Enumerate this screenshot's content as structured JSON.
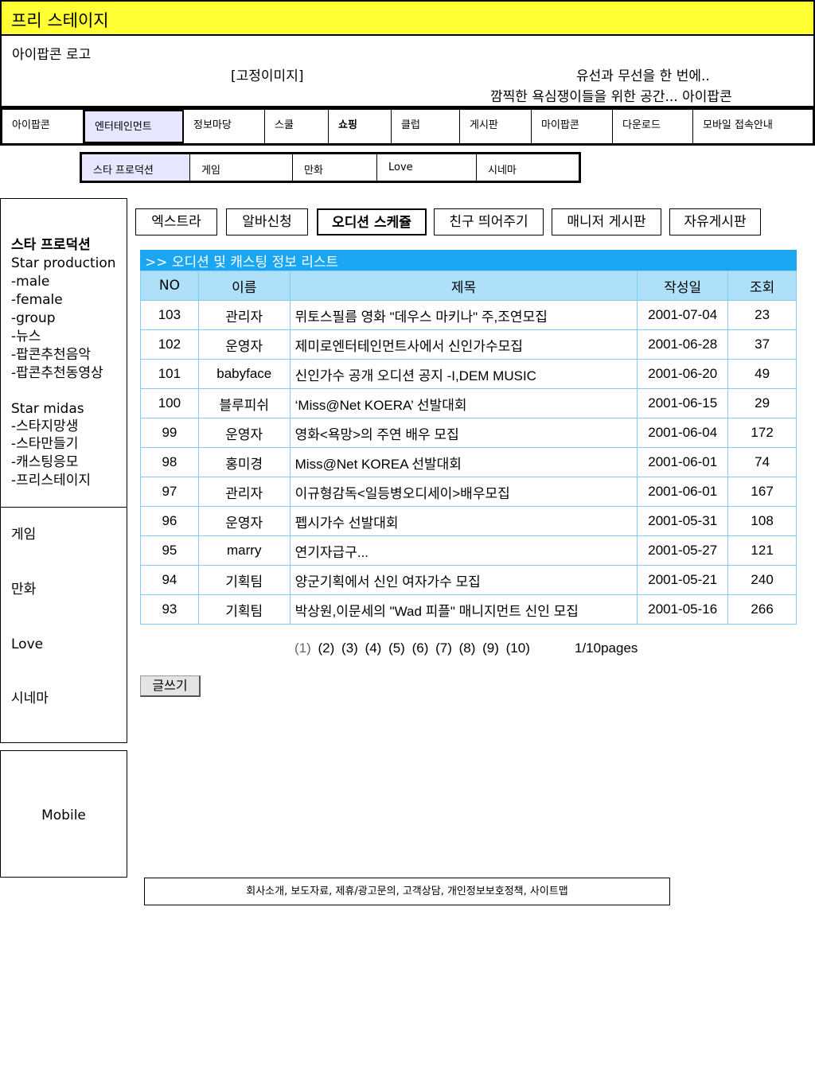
{
  "titlebar": {
    "title": "프리 스테이지"
  },
  "header": {
    "logo": "아이팝콘 로고",
    "fixed_image": "[고정이미지]",
    "slogan_1": "유선과 무선을 한 번에..",
    "slogan_2": "깜찍한 욕심쟁이들을 위한 공간... 아이팝콘"
  },
  "main_nav": [
    {
      "label": "아이팝콘"
    },
    {
      "label": "엔터테인먼트"
    },
    {
      "label": "정보마당"
    },
    {
      "label": "스쿨"
    },
    {
      "label": "쇼핑"
    },
    {
      "label": "클럽"
    },
    {
      "label": "게시판"
    },
    {
      "label": "마이팝콘"
    },
    {
      "label": "다운로드"
    },
    {
      "label": "모바일 접속안내"
    }
  ],
  "sub_nav": [
    {
      "label": "스타 프로덕션"
    },
    {
      "label": "게임"
    },
    {
      "label": "만화"
    },
    {
      "label": "Love"
    },
    {
      "label": "시네마"
    }
  ],
  "left_menu": {
    "section_title": "스타 프로덕션",
    "items": [
      "Star production",
      "-male",
      "-female",
      "-group",
      "-뉴스",
      "-팝콘추천음악",
      "-팝콘추천동영상",
      "",
      "Star midas",
      "-스타지망생",
      "-스타만들기",
      "-캐스팅응모",
      "-프리스테이지"
    ],
    "lower_items": [
      "게임",
      "만화",
      "Love",
      "시네마"
    ]
  },
  "mobile": {
    "label": "Mobile"
  },
  "tabs": [
    {
      "label": "엑스트라"
    },
    {
      "label": "알바신청"
    },
    {
      "label": "오디션 스케쥴"
    },
    {
      "label": "친구 띄어주기"
    },
    {
      "label": "매니저 게시판"
    },
    {
      "label": "자유게시판"
    }
  ],
  "list": {
    "header": ">> 오디션 및 캐스팅 정보 리스트",
    "columns": [
      "NO",
      "이름",
      "제목",
      "작성일",
      "조회"
    ],
    "rows": [
      [
        "103",
        "관리자",
        "뮈토스필름 영화 \"데우스 마키나\" 주,조연모집",
        "2001-07-04",
        "23"
      ],
      [
        "102",
        "운영자",
        "제미로엔터테인먼트사에서 신인가수모집",
        "2001-06-28",
        "37"
      ],
      [
        "101",
        "babyface",
        "신인가수 공개 오디션 공지 -I,DEM MUSIC",
        "2001-06-20",
        "49"
      ],
      [
        "100",
        "블루피쉬",
        "‘Miss@Net KOERA’ 선발대회",
        "2001-06-15",
        "29"
      ],
      [
        "99",
        "운영자",
        "영화<욕망>의 주연 배우 모집",
        "2001-06-04",
        "172"
      ],
      [
        "98",
        "홍미경",
        "Miss@Net KOREA 선발대회",
        "2001-06-01",
        "74"
      ],
      [
        "97",
        "관리자",
        "이규형감독<일등병오디세이>배우모집",
        "2001-06-01",
        "167"
      ],
      [
        "96",
        "운영자",
        "펩시가수 선발대회",
        "2001-05-31",
        "108"
      ],
      [
        "95",
        "marry",
        "연기자급구...",
        "2001-05-27",
        "121"
      ],
      [
        "94",
        "기획팀",
        "양군기획에서 신인 여자가수 모집",
        "2001-05-21",
        "240"
      ],
      [
        "93",
        "기획팀",
        "박상원,이문세의 \"Wad 피플\" 매니지먼트 신인 모집",
        "2001-05-16",
        "266"
      ]
    ]
  },
  "pagination": {
    "pages": [
      "(1)",
      "(2)",
      "(3)",
      "(4)",
      "(5)",
      "(6)",
      "(7)",
      "(8)",
      "(9)",
      "(10)"
    ],
    "info": "1/10pages"
  },
  "write_button": {
    "label": "글쓰기"
  },
  "footer": {
    "text": "회사소개, 보도자료, 제휴/광고문의, 고객상담, 개인정보보호정책, 사이트맵"
  }
}
